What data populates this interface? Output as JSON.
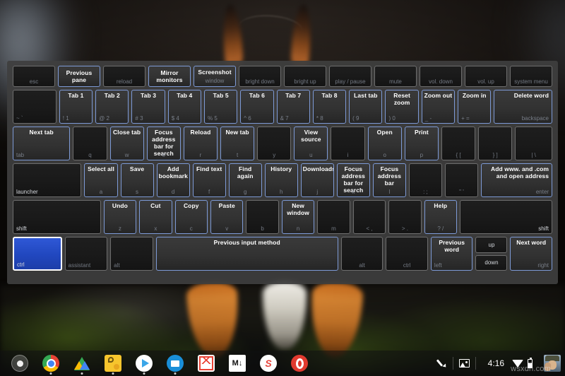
{
  "os": "ChromeOS",
  "overlay": {
    "title": "Keyboard shortcut overlay",
    "modifier_held": "ctrl",
    "accent_lit": "#7d9ad6",
    "accent_pressed": "#2147bf",
    "panel_bg": "#3e3e3e",
    "rows": [
      {
        "name": "function-row",
        "keys": [
          {
            "name": "esc",
            "legend": "esc",
            "legend_align": "c",
            "shortcut": "",
            "lit": false,
            "dark": true
          },
          {
            "name": "back",
            "legend": "",
            "legend_align": "c",
            "shortcut": "Previous pane",
            "lit": true,
            "dark": false
          },
          {
            "name": "reload",
            "legend": "reload",
            "legend_align": "c",
            "shortcut": "",
            "lit": false,
            "dark": true
          },
          {
            "name": "fullscreen",
            "legend": "",
            "legend_align": "c",
            "shortcut": "Mirror monitors",
            "lit": true,
            "dark": false
          },
          {
            "name": "overview",
            "legend": "window",
            "legend_align": "c",
            "shortcut": "Screenshot",
            "lit": true,
            "dark": false,
            "two_line": true
          },
          {
            "name": "brightness-down",
            "legend": "bright down",
            "legend_align": "c",
            "shortcut": "",
            "lit": false,
            "dark": true
          },
          {
            "name": "brightness-up",
            "legend": "bright up",
            "legend_align": "c",
            "shortcut": "",
            "lit": false,
            "dark": true
          },
          {
            "name": "play-pause",
            "legend": "play / pause",
            "legend_align": "c",
            "shortcut": "",
            "lit": false,
            "dark": true
          },
          {
            "name": "mute",
            "legend": "mute",
            "legend_align": "c",
            "shortcut": "",
            "lit": false,
            "dark": true
          },
          {
            "name": "volume-down",
            "legend": "vol. down",
            "legend_align": "c",
            "shortcut": "",
            "lit": false,
            "dark": true
          },
          {
            "name": "volume-up",
            "legend": "vol. up",
            "legend_align": "c",
            "shortcut": "",
            "lit": false,
            "dark": true
          },
          {
            "name": "system-menu",
            "legend": "system menu",
            "legend_align": "c",
            "shortcut": "",
            "lit": false,
            "dark": true
          }
        ]
      },
      {
        "name": "number-row",
        "keys": [
          {
            "name": "backtick",
            "legend": "~ `",
            "legend_align": "l",
            "shortcut": "",
            "lit": false,
            "dark": true,
            "flex": 1.32
          },
          {
            "name": "digit-1",
            "legend": "! 1",
            "legend_align": "l",
            "shortcut": "Tab 1",
            "lit": true,
            "dark": false,
            "flex": 1
          },
          {
            "name": "digit-2",
            "legend": "@ 2",
            "legend_align": "l",
            "shortcut": "Tab 2",
            "lit": true,
            "dark": false,
            "flex": 1
          },
          {
            "name": "digit-3",
            "legend": "# 3",
            "legend_align": "l",
            "shortcut": "Tab 3",
            "lit": true,
            "dark": false,
            "flex": 1
          },
          {
            "name": "digit-4",
            "legend": "$ 4",
            "legend_align": "l",
            "shortcut": "Tab 4",
            "lit": true,
            "dark": false,
            "flex": 1
          },
          {
            "name": "digit-5",
            "legend": "% 5",
            "legend_align": "l",
            "shortcut": "Tab 5",
            "lit": true,
            "dark": false,
            "flex": 1
          },
          {
            "name": "digit-6",
            "legend": "^ 6",
            "legend_align": "l",
            "shortcut": "Tab 6",
            "lit": true,
            "dark": false,
            "flex": 1
          },
          {
            "name": "digit-7",
            "legend": "& 7",
            "legend_align": "l",
            "shortcut": "Tab 7",
            "lit": true,
            "dark": false,
            "flex": 1
          },
          {
            "name": "digit-8",
            "legend": "* 8",
            "legend_align": "l",
            "shortcut": "Tab 8",
            "lit": true,
            "dark": false,
            "flex": 1
          },
          {
            "name": "digit-9",
            "legend": "( 9",
            "legend_align": "l",
            "shortcut": "Last tab",
            "lit": true,
            "dark": false,
            "flex": 1
          },
          {
            "name": "digit-0",
            "legend": ") 0",
            "legend_align": "l",
            "shortcut": "Reset zoom",
            "lit": true,
            "dark": false,
            "flex": 1
          },
          {
            "name": "minus",
            "legend": "_ -",
            "legend_align": "l",
            "shortcut": "Zoom out",
            "lit": true,
            "dark": false,
            "flex": 1
          },
          {
            "name": "equals",
            "legend": "+ =",
            "legend_align": "l",
            "shortcut": "Zoom in",
            "lit": true,
            "dark": false,
            "flex": 1
          },
          {
            "name": "backspace",
            "legend": "backspace",
            "legend_align": "r",
            "shortcut": "Delete word",
            "lit": true,
            "dark": false,
            "flex": 1.78,
            "shortcut_align": "right"
          }
        ]
      },
      {
        "name": "tab-row",
        "keys": [
          {
            "name": "tab",
            "legend": "tab",
            "legend_align": "l",
            "shortcut": "Next tab",
            "lit": true,
            "dark": false,
            "flex": 1.72,
            "shortcut_align": "left"
          },
          {
            "name": "letter-q",
            "legend": "q",
            "legend_align": "c",
            "shortcut": "",
            "lit": false,
            "dark": true,
            "flex": 1
          },
          {
            "name": "letter-w",
            "legend": "w",
            "legend_align": "c",
            "shortcut": "Close tab",
            "lit": true,
            "dark": false,
            "flex": 1
          },
          {
            "name": "letter-e",
            "legend": "e",
            "legend_align": "c",
            "shortcut": "Focus address bar for search",
            "lit": true,
            "dark": false,
            "flex": 1
          },
          {
            "name": "letter-r",
            "legend": "r",
            "legend_align": "c",
            "shortcut": "Reload",
            "lit": true,
            "dark": false,
            "flex": 1
          },
          {
            "name": "letter-t",
            "legend": "t",
            "legend_align": "c",
            "shortcut": "New tab",
            "lit": true,
            "dark": false,
            "flex": 1
          },
          {
            "name": "letter-y",
            "legend": "y",
            "legend_align": "c",
            "shortcut": "",
            "lit": false,
            "dark": true,
            "flex": 1
          },
          {
            "name": "letter-u",
            "legend": "u",
            "legend_align": "c",
            "shortcut": "View source",
            "lit": true,
            "dark": false,
            "flex": 1
          },
          {
            "name": "letter-i",
            "legend": "i",
            "legend_align": "c",
            "shortcut": "",
            "lit": false,
            "dark": true,
            "flex": 1
          },
          {
            "name": "letter-o",
            "legend": "o",
            "legend_align": "c",
            "shortcut": "Open",
            "lit": true,
            "dark": false,
            "flex": 1
          },
          {
            "name": "letter-p",
            "legend": "p",
            "legend_align": "c",
            "shortcut": "Print",
            "lit": true,
            "dark": false,
            "flex": 1
          },
          {
            "name": "bracket-left",
            "legend": "{ [",
            "legend_align": "c",
            "shortcut": "",
            "lit": false,
            "dark": true,
            "flex": 1
          },
          {
            "name": "bracket-right",
            "legend": "} ]",
            "legend_align": "c",
            "shortcut": "",
            "lit": false,
            "dark": true,
            "flex": 1
          },
          {
            "name": "backslash",
            "legend": "| \\",
            "legend_align": "c",
            "shortcut": "",
            "lit": false,
            "dark": true,
            "flex": 1.1
          }
        ]
      },
      {
        "name": "home-row",
        "keys": [
          {
            "name": "launcher",
            "legend": "launcher",
            "legend_align": "l",
            "shortcut": "",
            "lit": false,
            "dark": true,
            "flex": 2.12,
            "legend_bright": true
          },
          {
            "name": "letter-a",
            "legend": "a",
            "legend_align": "c",
            "shortcut": "Select all",
            "lit": true,
            "dark": false,
            "flex": 1
          },
          {
            "name": "letter-s",
            "legend": "s",
            "legend_align": "c",
            "shortcut": "Save",
            "lit": true,
            "dark": false,
            "flex": 1
          },
          {
            "name": "letter-d",
            "legend": "d",
            "legend_align": "c",
            "shortcut": "Add bookmark",
            "lit": true,
            "dark": false,
            "flex": 1
          },
          {
            "name": "letter-f",
            "legend": "f",
            "legend_align": "c",
            "shortcut": "Find text",
            "lit": true,
            "dark": false,
            "flex": 1
          },
          {
            "name": "letter-g",
            "legend": "g",
            "legend_align": "c",
            "shortcut": "Find again",
            "lit": true,
            "dark": false,
            "flex": 1
          },
          {
            "name": "letter-h",
            "legend": "h",
            "legend_align": "c",
            "shortcut": "History",
            "lit": true,
            "dark": false,
            "flex": 1
          },
          {
            "name": "letter-j",
            "legend": "j",
            "legend_align": "c",
            "shortcut": "Downloads",
            "lit": true,
            "dark": false,
            "flex": 1
          },
          {
            "name": "letter-k",
            "legend": "k",
            "legend_align": "c",
            "shortcut": "Focus address bar for search",
            "lit": true,
            "dark": false,
            "flex": 1
          },
          {
            "name": "letter-l",
            "legend": "l",
            "legend_align": "c",
            "shortcut": "Focus address bar",
            "lit": true,
            "dark": false,
            "flex": 1
          },
          {
            "name": "semicolon",
            "legend": ": ;",
            "legend_align": "c",
            "shortcut": "",
            "lit": false,
            "dark": true,
            "flex": 1
          },
          {
            "name": "quote",
            "legend": "\" '",
            "legend_align": "c",
            "shortcut": "",
            "lit": false,
            "dark": true,
            "flex": 1
          },
          {
            "name": "enter",
            "legend": "enter",
            "legend_align": "r",
            "shortcut": "Add www. and .com and open address",
            "lit": true,
            "dark": false,
            "flex": 2.2,
            "shortcut_align": "right"
          }
        ]
      },
      {
        "name": "shift-row",
        "keys": [
          {
            "name": "shift-left",
            "legend": "shift",
            "legend_align": "l",
            "shortcut": "",
            "lit": false,
            "dark": true,
            "flex": 2.76,
            "legend_bright": true
          },
          {
            "name": "letter-z",
            "legend": "z",
            "legend_align": "c",
            "shortcut": "Undo",
            "lit": true,
            "dark": false,
            "flex": 1
          },
          {
            "name": "letter-x",
            "legend": "x",
            "legend_align": "c",
            "shortcut": "Cut",
            "lit": true,
            "dark": false,
            "flex": 1
          },
          {
            "name": "letter-c",
            "legend": "c",
            "legend_align": "c",
            "shortcut": "Copy",
            "lit": true,
            "dark": false,
            "flex": 1
          },
          {
            "name": "letter-v",
            "legend": "v",
            "legend_align": "c",
            "shortcut": "Paste",
            "lit": true,
            "dark": false,
            "flex": 1
          },
          {
            "name": "letter-b",
            "legend": "b",
            "legend_align": "c",
            "shortcut": "",
            "lit": false,
            "dark": true,
            "flex": 1
          },
          {
            "name": "letter-n",
            "legend": "n",
            "legend_align": "c",
            "shortcut": "New window",
            "lit": true,
            "dark": false,
            "flex": 1
          },
          {
            "name": "letter-m",
            "legend": "m",
            "legend_align": "c",
            "shortcut": "",
            "lit": false,
            "dark": true,
            "flex": 1
          },
          {
            "name": "comma",
            "legend": "< ,",
            "legend_align": "c",
            "shortcut": "",
            "lit": false,
            "dark": true,
            "flex": 1
          },
          {
            "name": "period",
            "legend": "> .",
            "legend_align": "c",
            "shortcut": "",
            "lit": false,
            "dark": true,
            "flex": 1
          },
          {
            "name": "slash",
            "legend": "? /",
            "legend_align": "c",
            "shortcut": "Help",
            "lit": true,
            "dark": false,
            "flex": 1
          },
          {
            "name": "shift-right",
            "legend": "shift",
            "legend_align": "r",
            "shortcut": "",
            "lit": false,
            "dark": true,
            "flex": 2.9,
            "legend_bright": true
          }
        ]
      },
      {
        "name": "bottom-row",
        "keys": [
          {
            "name": "ctrl-left",
            "legend": "ctrl",
            "legend_align": "l",
            "shortcut": "",
            "lit": false,
            "dark": false,
            "flex": 1.46,
            "pressed": true,
            "legend_bright": true
          },
          {
            "name": "assistant",
            "legend": "assistant",
            "legend_align": "l",
            "shortcut": "",
            "lit": false,
            "dark": true,
            "flex": 1.3
          },
          {
            "name": "alt-left",
            "legend": "alt",
            "legend_align": "l",
            "shortcut": "",
            "lit": false,
            "dark": true,
            "flex": 1.3
          },
          {
            "name": "space",
            "legend": "",
            "legend_align": "c",
            "shortcut": "Previous input method",
            "lit": true,
            "dark": false,
            "flex": 5.7
          },
          {
            "name": "alt-right",
            "legend": "alt",
            "legend_align": "c",
            "shortcut": "",
            "lit": false,
            "dark": true,
            "flex": 1.28
          },
          {
            "name": "ctrl-right",
            "legend": "ctrl",
            "legend_align": "c",
            "shortcut": "",
            "lit": false,
            "dark": true,
            "flex": 1.28
          },
          {
            "name": "arrow-left",
            "legend": "left",
            "legend_align": "l",
            "shortcut": "Previous word",
            "lit": true,
            "dark": false,
            "flex": 1.28
          }
        ],
        "arrow_stack": [
          {
            "name": "arrow-up",
            "label": "up"
          },
          {
            "name": "arrow-down",
            "label": "down"
          }
        ],
        "trailing": {
          "name": "arrow-right",
          "legend": "right",
          "legend_align": "r",
          "shortcut": "Next word",
          "lit": true,
          "flex": 1.28
        }
      }
    ]
  },
  "shelf": {
    "apps": [
      {
        "name": "launcher-button",
        "icon": "launcher-icon",
        "label": "",
        "running": false
      },
      {
        "name": "shelf-app-chrome",
        "icon": "chrome-icon",
        "label": "",
        "running": true
      },
      {
        "name": "shelf-app-drive",
        "icon": "drive-icon",
        "label": "",
        "running": true
      },
      {
        "name": "shelf-app-keep",
        "icon": "keep-icon",
        "label": "",
        "running": true
      },
      {
        "name": "shelf-app-play",
        "icon": "play-store-icon",
        "label": "",
        "running": true
      },
      {
        "name": "shelf-app-files",
        "icon": "files-icon",
        "label": "",
        "running": true
      },
      {
        "name": "shelf-app-gmail",
        "icon": "gmail-icon",
        "label": "",
        "running": false
      },
      {
        "name": "shelf-app-markdown",
        "icon": "markdown-icon",
        "label": "M↓",
        "running": false
      },
      {
        "name": "shelf-app-s",
        "icon": "s-app-icon",
        "label": "S",
        "running": false
      },
      {
        "name": "shelf-app-opera",
        "icon": "opera-icon",
        "label": "",
        "running": false
      }
    ],
    "tray": {
      "stylus_icon": "stylus-icon",
      "screenshot_icon": "screen-capture-icon",
      "clock": "4:16",
      "wifi_icon": "wifi-icon",
      "battery_icon": "battery-icon",
      "avatar": "user-avatar"
    }
  },
  "watermark": "wsxdn.com"
}
